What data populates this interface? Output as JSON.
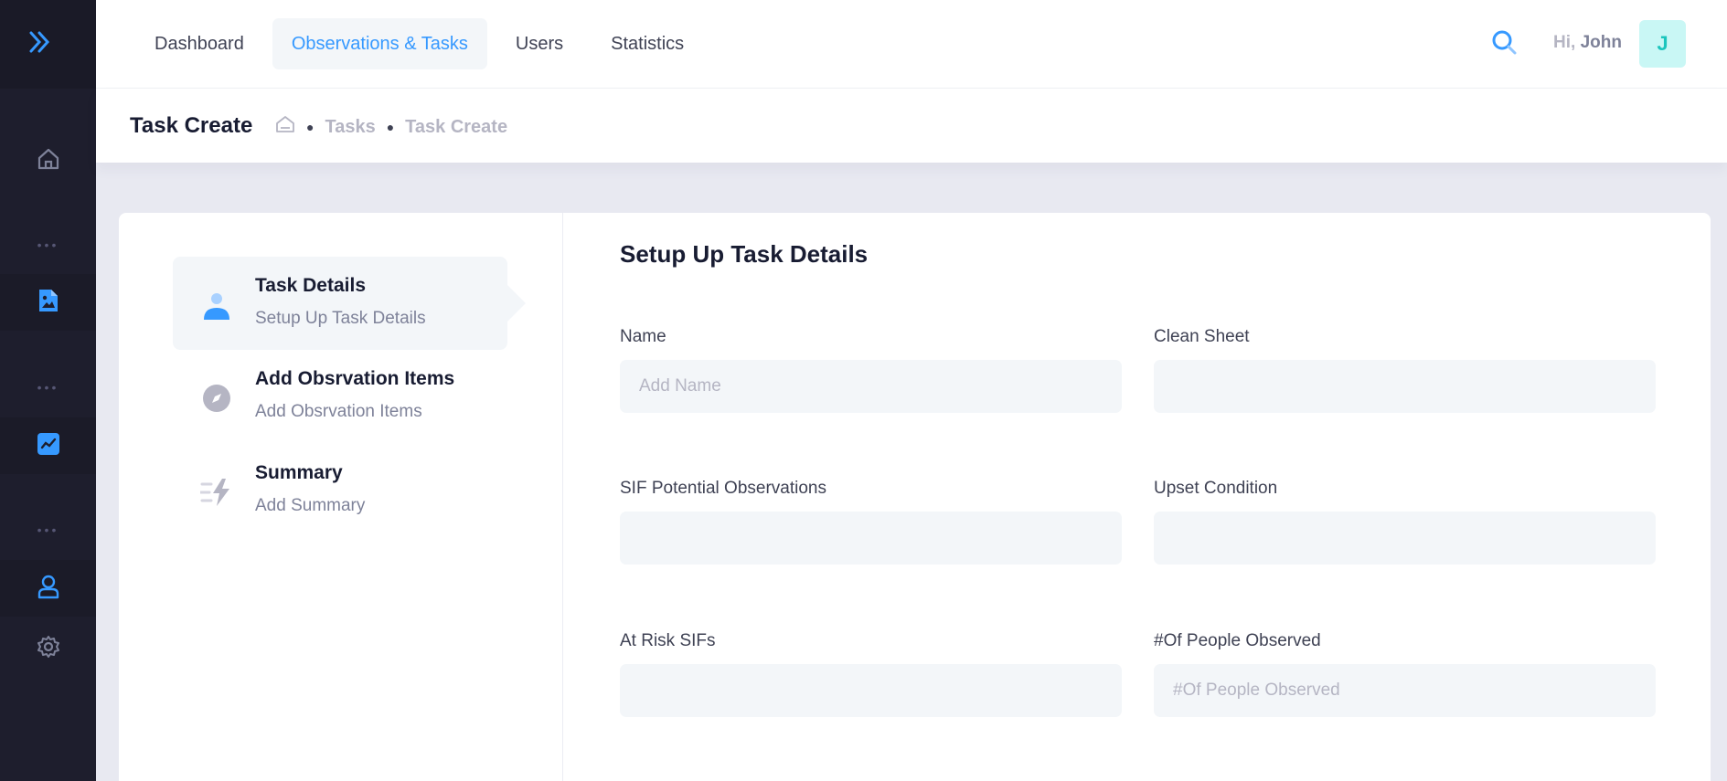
{
  "header": {
    "nav": [
      {
        "label": "Dashboard"
      },
      {
        "label": "Observations & Tasks"
      },
      {
        "label": "Users"
      },
      {
        "label": "Statistics"
      }
    ],
    "greeting_prefix": "Hi,",
    "user_name": "John",
    "avatar_initial": "J"
  },
  "subheader": {
    "title": "Task Create",
    "breadcrumb": [
      "Tasks",
      "Task Create"
    ]
  },
  "sidebar": {
    "icons": [
      "logo-chevrons-icon",
      "home-icon",
      "document-image-icon",
      "chart-icon",
      "user-icon",
      "gear-icon"
    ],
    "active_color": "#3699ff"
  },
  "wizard": {
    "steps": [
      {
        "title": "Task Details",
        "desc": "Setup Up Task Details"
      },
      {
        "title": "Add Obsrvation Items",
        "desc": "Add Obsrvation Items"
      },
      {
        "title": "Summary",
        "desc": "Add Summary"
      }
    ]
  },
  "form": {
    "title": "Setup Up Task Details",
    "fields": [
      {
        "label": "Name",
        "placeholder": "Add Name",
        "value": ""
      },
      {
        "label": "Clean Sheet",
        "placeholder": "",
        "value": ""
      },
      {
        "label": "SIF Potential Observations",
        "placeholder": "",
        "value": ""
      },
      {
        "label": "Upset Condition",
        "placeholder": "",
        "value": ""
      },
      {
        "label": "At Risk SIFs",
        "placeholder": "",
        "value": ""
      },
      {
        "label": "#Of People Observed",
        "placeholder": "#Of People Observed",
        "value": ""
      }
    ]
  }
}
